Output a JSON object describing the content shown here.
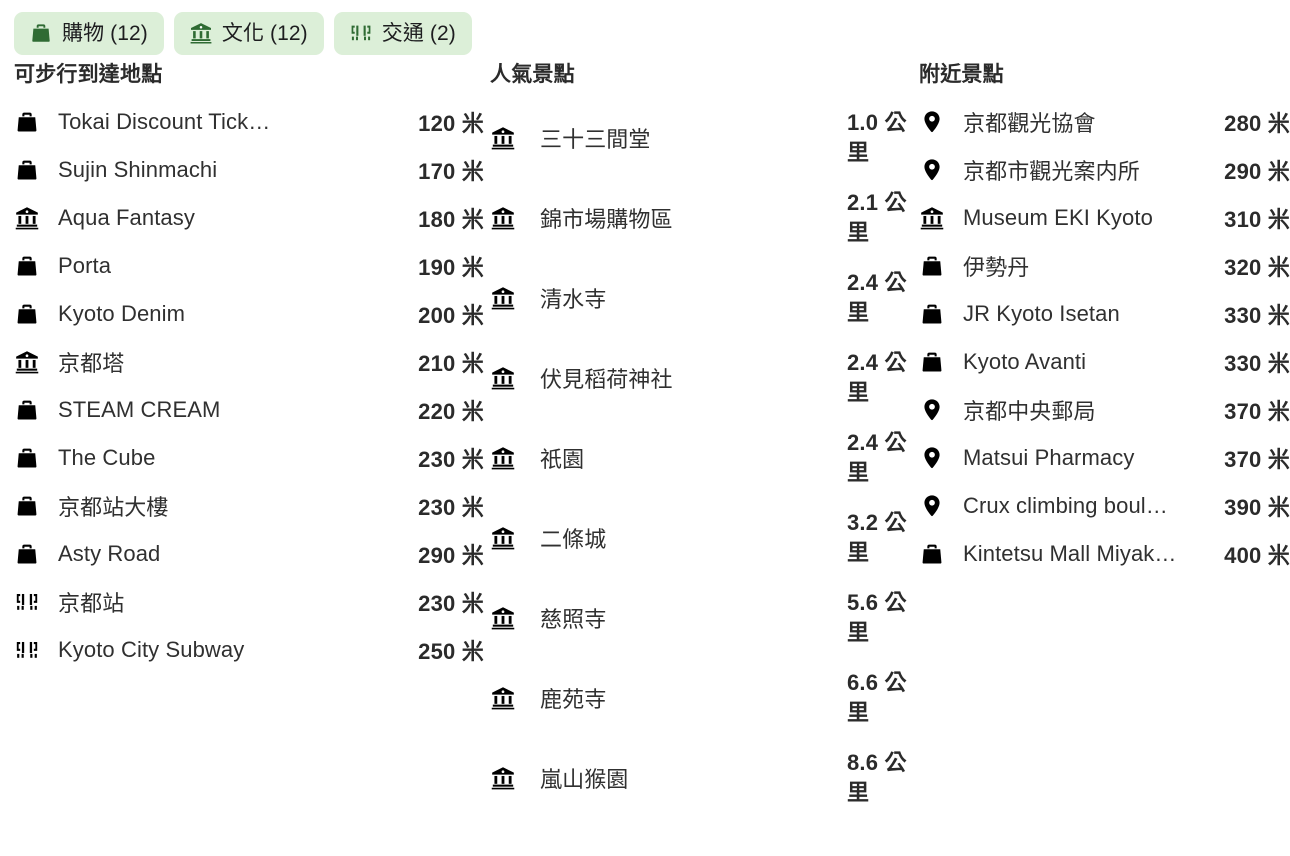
{
  "filters": [
    {
      "icon": "shopping-bag-icon",
      "label": "購物 (12)"
    },
    {
      "icon": "museum-icon",
      "label": "文化 (12)"
    },
    {
      "icon": "transit-icon",
      "label": "交通 (2)"
    }
  ],
  "colors": {
    "chip_background": "#dcefd8",
    "chip_icon": "#2f6b33",
    "text": "#2b2b2b",
    "name_text": "#303030",
    "icon": "#000000",
    "page_background": "#ffffff"
  },
  "columns": {
    "walkable": {
      "title": "可步行到達地點",
      "rows": [
        {
          "icon": "shopping-bag-icon",
          "name": "Tokai Discount Tick…",
          "distance": "120 米"
        },
        {
          "icon": "shopping-bag-icon",
          "name": "Sujin Shinmachi",
          "distance": "170 米"
        },
        {
          "icon": "museum-icon",
          "name": "Aqua Fantasy",
          "distance": "180 米"
        },
        {
          "icon": "shopping-bag-icon",
          "name": "Porta",
          "distance": "190 米"
        },
        {
          "icon": "shopping-bag-icon",
          "name": "Kyoto Denim",
          "distance": "200 米"
        },
        {
          "icon": "museum-icon",
          "name": "京都塔",
          "distance": "210 米"
        },
        {
          "icon": "shopping-bag-icon",
          "name": "STEAM CREAM",
          "distance": "220 米"
        },
        {
          "icon": "shopping-bag-icon",
          "name": "The Cube",
          "distance": "230 米"
        },
        {
          "icon": "shopping-bag-icon",
          "name": "京都站大樓",
          "distance": "230 米"
        },
        {
          "icon": "shopping-bag-icon",
          "name": "Asty Road",
          "distance": "290 米"
        },
        {
          "icon": "transit-icon",
          "name": "京都站",
          "distance": "230 米"
        },
        {
          "icon": "transit-icon",
          "name": "Kyoto City Subway",
          "distance": "250 米"
        }
      ]
    },
    "popular": {
      "title": "人氣景點",
      "rows": [
        {
          "icon": "museum-icon",
          "name": "三十三間堂",
          "distance": "1.0 公里"
        },
        {
          "icon": "museum-icon",
          "name": "錦市場購物區",
          "distance": "2.1 公里"
        },
        {
          "icon": "museum-icon",
          "name": "清水寺",
          "distance": "2.4 公里"
        },
        {
          "icon": "museum-icon",
          "name": "伏見稻荷神社",
          "distance": "2.4 公里"
        },
        {
          "icon": "museum-icon",
          "name": "祇園",
          "distance": "2.4 公里"
        },
        {
          "icon": "museum-icon",
          "name": "二條城",
          "distance": "3.2 公里"
        },
        {
          "icon": "museum-icon",
          "name": "慈照寺",
          "distance": "5.6 公里"
        },
        {
          "icon": "museum-icon",
          "name": "鹿苑寺",
          "distance": "6.6 公里"
        },
        {
          "icon": "museum-icon",
          "name": "嵐山猴園",
          "distance": "8.6 公里"
        }
      ]
    },
    "nearby": {
      "title": "附近景點",
      "rows": [
        {
          "icon": "map-pin-icon",
          "name": "京都觀光協會",
          "distance": "280 米"
        },
        {
          "icon": "map-pin-icon",
          "name": "京都市觀光案内所",
          "distance": "290 米"
        },
        {
          "icon": "museum-icon",
          "name": "Museum EKI Kyoto",
          "distance": "310 米"
        },
        {
          "icon": "shopping-bag-icon",
          "name": "伊勢丹",
          "distance": "320 米"
        },
        {
          "icon": "shopping-bag-icon",
          "name": "JR Kyoto Isetan",
          "distance": "330 米"
        },
        {
          "icon": "shopping-bag-icon",
          "name": "Kyoto Avanti",
          "distance": "330 米"
        },
        {
          "icon": "map-pin-icon",
          "name": "京都中央郵局",
          "distance": "370 米"
        },
        {
          "icon": "map-pin-icon",
          "name": "Matsui Pharmacy",
          "distance": "370 米"
        },
        {
          "icon": "map-pin-icon",
          "name": "Crux climbing boul…",
          "distance": "390 米"
        },
        {
          "icon": "shopping-bag-icon",
          "name": "Kintetsu Mall Miyak…",
          "distance": "400 米"
        }
      ]
    }
  }
}
